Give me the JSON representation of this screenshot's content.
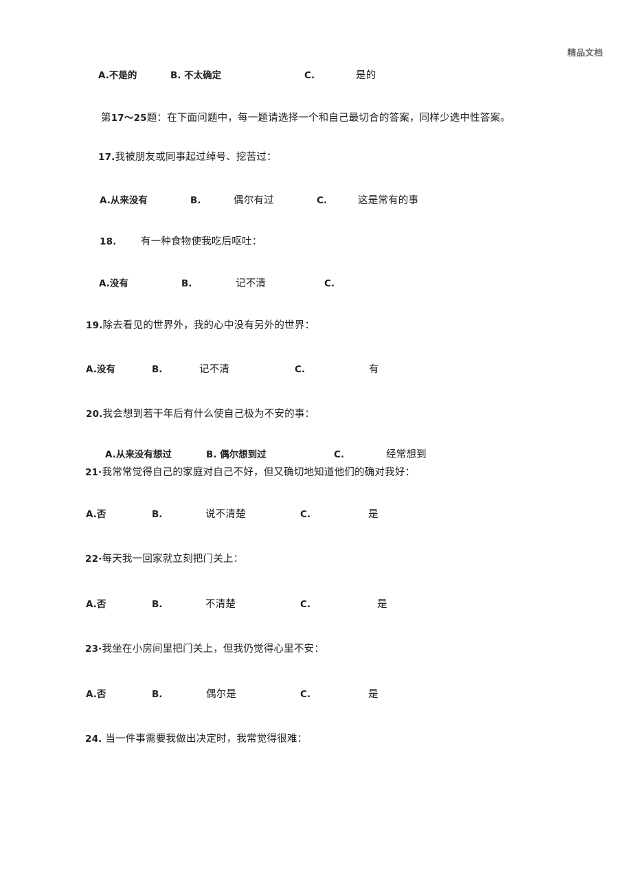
{
  "document": {
    "header_mark": "精品文档",
    "page_background": "#ffffff",
    "text_color": "#1f1f1f",
    "header_color": "#6b6b6b"
  },
  "blocks": {
    "prev_question_options": {
      "a_label": "A.不是的",
      "b_label": "B. 不太确定",
      "c_label": "C.",
      "c_text": "是的"
    },
    "instruction": {
      "range_prefix": "第",
      "range": "17～25",
      "text": "题：在下面问题中，每一题请选择一个和自己最切合的答案，同样少选中性答案。"
    }
  },
  "questions": [
    {
      "number": "17.",
      "stem": "我被朋友或同事起过绰号、挖苦过：",
      "options": {
        "a_label": "A.从来没有",
        "b_label": "B.",
        "b_text": "偶尔有过",
        "c_label": "C.",
        "c_text": "这是常有的事"
      }
    },
    {
      "number": "18.",
      "stem": "有一种食物使我吃后呕吐：",
      "options": {
        "a_label": "A.没有",
        "b_label": "B.",
        "b_text": "记不清",
        "c_label": "C.",
        "c_text": ""
      }
    },
    {
      "number": "19.",
      "stem": "除去看见的世界外，我的心中没有另外的世界：",
      "options": {
        "a_label": "A.没有",
        "b_label": "B.",
        "b_text": "记不清",
        "c_label": "C.",
        "c_text": "有"
      }
    },
    {
      "number": "20.",
      "stem": "我会想到若干年后有什么使自己极为不安的事：",
      "options": {
        "a_label": "A.从来没有想过",
        "b_label": "B. 偶尔想到过",
        "c_label": "C.",
        "c_text": "经常想到"
      }
    },
    {
      "number": "21·",
      "stem": "我常常觉得自己的家庭对自己不好，但又确切地知道他们的确对我好：",
      "options": {
        "a_label": "A.否",
        "b_label": "B.",
        "b_text": "说不清楚",
        "c_label": "C.",
        "c_text": "是"
      }
    },
    {
      "number": "22·",
      "stem": "每天我一回家就立刻把门关上：",
      "options": {
        "a_label": "A.否",
        "b_label": "B.",
        "b_text": "不清楚",
        "c_label": "C.",
        "c_text": "是"
      }
    },
    {
      "number": "23·",
      "stem": "我坐在小房间里把门关上，但我仍觉得心里不安：",
      "options": {
        "a_label": "A.否",
        "b_label": "B.",
        "b_text": "偶尔是",
        "c_label": "C.",
        "c_text": "是"
      }
    },
    {
      "number": "24.",
      "stem": " 当一件事需要我做出决定时，我常觉得很难：",
      "options": null
    }
  ]
}
